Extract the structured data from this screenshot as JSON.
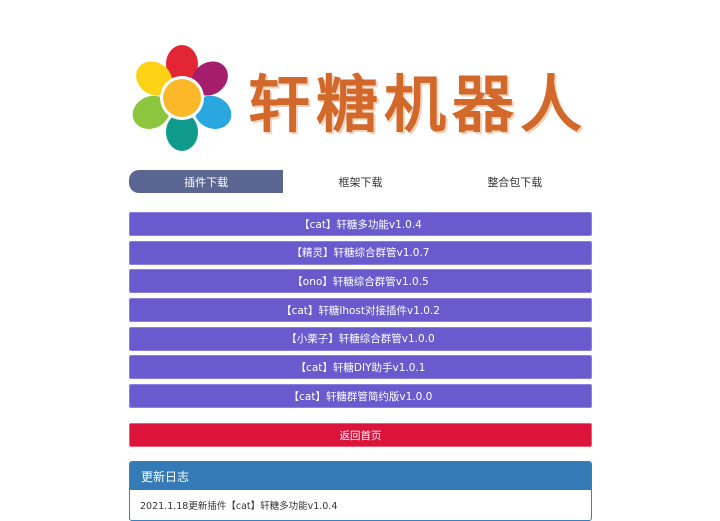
{
  "brand": {
    "title": "轩糖机器人"
  },
  "tabs": [
    {
      "label": "插件下载"
    },
    {
      "label": "框架下载"
    },
    {
      "label": "整合包下载"
    }
  ],
  "downloads": [
    {
      "label": "【cat】轩糖多功能v1.0.4"
    },
    {
      "label": "【精灵】轩糖综合群管v1.0.7"
    },
    {
      "label": "【ono】轩糖综合群管v1.0.5"
    },
    {
      "label": "【cat】轩糖lhost对接插件v1.0.2"
    },
    {
      "label": "【小栗子】轩糖综合群管v1.0.0"
    },
    {
      "label": "【cat】轩糖DIY助手v1.0.1"
    },
    {
      "label": "【cat】轩糖群管简约版v1.0.0"
    }
  ],
  "back_label": "返回首页",
  "changelog": {
    "title": "更新日志",
    "first_entry": "2021.1.18更新插件【cat】轩糖多功能v1.0.4"
  },
  "colors": {
    "brand": "#d2692a",
    "tab_active": "#5a6591",
    "download_button": "#6a5acd",
    "back_button": "#dc143c",
    "panel_header": "#337ab7"
  }
}
